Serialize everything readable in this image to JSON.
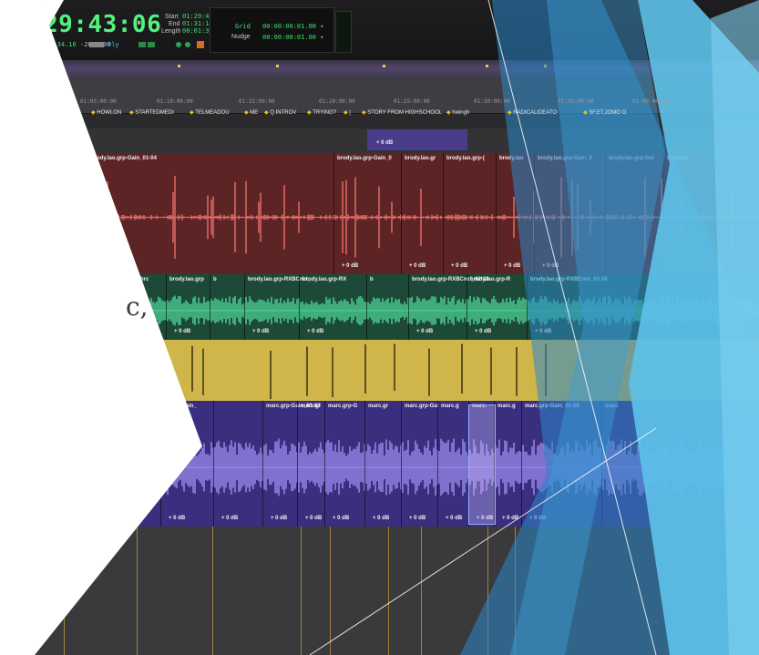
{
  "transport": {
    "main_counter": "29:43:06",
    "main_counter_arrow": "▾",
    "sub_counter": "50:34.16",
    "sub_value": "-2606606",
    "sub_mode": "Dly",
    "start_label": "Start",
    "end_label": "End",
    "length_label": "Length",
    "start_value": "01:29:43:06",
    "end_value": "01:31:14:27",
    "length_value": "00:01:31:21",
    "grid_label": "Grid",
    "grid_value": "00:00:00:01.00 ▾",
    "nudge_label": "Nudge",
    "nudge_value": "00:00:00:01.00 ▾"
  },
  "ruler": {
    "timecodes": [
      "01:05:00:00",
      "01:10:00:00",
      "01:15:00:00",
      "01:20:00:00",
      "01:25:00:00",
      "01:30:00:00",
      "01:35:00:00",
      "01:40:00:00"
    ],
    "markers": [
      "HOWLON",
      "STARTEDMEDI",
      "TELMEADOU",
      "ME",
      "Q.INTROV",
      "TRYING?",
      "|",
      "STORY FROM HIGHSCHOOL",
      "hwingh",
      "RADICALIDEATO",
      "SF,ET,JOMO O"
    ]
  },
  "tracks": {
    "empty_gain": "+ 0 dB",
    "red": {
      "clips": [
        {
          "name": "brody.lao.grp-Gain_01-04",
          "gain": ""
        },
        {
          "name": "brody.lao.grp-Gain_0",
          "gain": "+ 0 dB"
        },
        {
          "name": "brody.lao.gr",
          "gain": "+ 0 dB"
        },
        {
          "name": "brody.lao.grp-(",
          "gain": "+ 0 dB"
        },
        {
          "name": "brody.lao",
          "gain": "+ 0 dB"
        },
        {
          "name": "brody.lao.grp-Gain_0",
          "gain": "+ 0 dB"
        },
        {
          "name": "brody.lao.grp-Gai",
          "gain": ""
        },
        {
          "name": "brody.la",
          "gain": ""
        }
      ]
    },
    "green": {
      "clips": [
        {
          "name": "grp-RX",
          "gain": ""
        },
        {
          "name": "brc",
          "gain": ""
        },
        {
          "name": "brody.lao.grp",
          "gain": "+ 0 dB"
        },
        {
          "name": "b",
          "gain": ""
        },
        {
          "name": "brody.lao.grp-RXBCnct_",
          "gain": "+ 0 dB"
        },
        {
          "name": "brody.lao.grp-RX",
          "gain": "+ 0 dB"
        },
        {
          "name": "b",
          "gain": ""
        },
        {
          "name": "brody.lao.grp-RXBCnct_02-38",
          "gain": "+ 0 dB"
        },
        {
          "name": "brody.lao.grp-R",
          "gain": "+ 0 dB"
        },
        {
          "name": "brody.lao.grp-RXBCnct_02-38",
          "gain": "+ 0 dB"
        }
      ]
    },
    "purple": {
      "clips": [
        {
          "name": "rc.grp-Gain_",
          "gain": "+ 0 dB"
        },
        {
          "name": "",
          "gain": "+ 0 dB"
        },
        {
          "name": "marc.grp-Gain_01-03",
          "gain": "+ 0 dB"
        },
        {
          "name": "marc.gr",
          "gain": "+ 0 dB"
        },
        {
          "name": "marc.grp-G",
          "gain": "+ 0 dB"
        },
        {
          "name": "marc.gr",
          "gain": "+ 0 dB"
        },
        {
          "name": "marc.grp-Gai",
          "gain": "+ 0 dB"
        },
        {
          "name": "marc.g",
          "gain": "+ 0 dB"
        },
        {
          "name": "marc.",
          "gain": "+ 0 dB"
        },
        {
          "name": "marc.g",
          "gain": "+ 0 dB"
        },
        {
          "name": "marc.grp-Gain_01-56",
          "gain": "+ 0 dB"
        },
        {
          "name": "marc",
          "gain": ""
        }
      ]
    }
  },
  "slide": {
    "title_fragment": "c,"
  },
  "colors": {
    "red_wave": "#e8706a",
    "green_wave": "#4fd69a",
    "yellow_wave": "#3a2f10",
    "purple_wave": "#a08cf0",
    "accent_blue": "#4aa6dc",
    "accent_light_blue": "#5fc3ea"
  }
}
